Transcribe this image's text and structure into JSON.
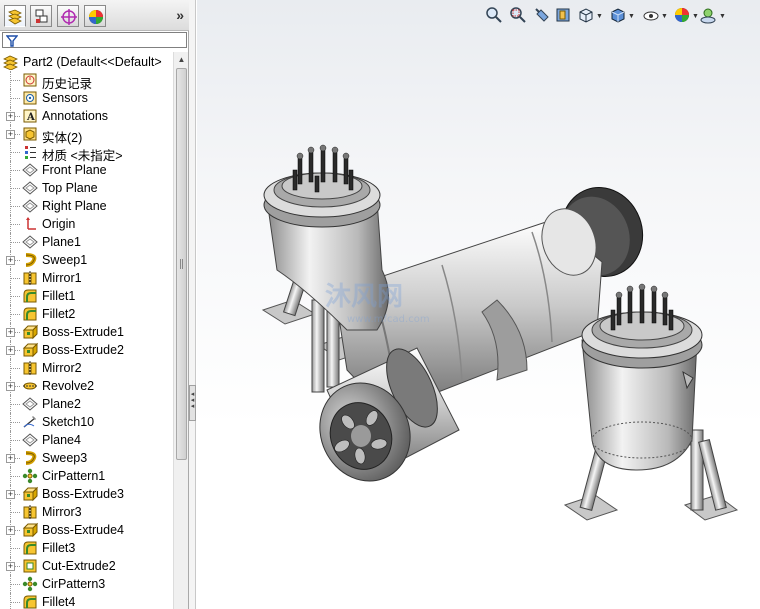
{
  "panel": {
    "tabs": [
      {
        "name": "featuremanager-tab",
        "icon": "featuremanager-icon"
      },
      {
        "name": "propertymanager-tab",
        "icon": "propertymanager-icon"
      },
      {
        "name": "configurationmanager-tab",
        "icon": "configurationmanager-icon"
      },
      {
        "name": "displaymanager-tab",
        "icon": "displaymanager-icon"
      }
    ],
    "expand_label": "»",
    "root_label": "Part2  (Default<<Default>"
  },
  "tree": {
    "items": [
      {
        "label": "历史记录",
        "icon": "history-icon",
        "expandable": false
      },
      {
        "label": "Sensors",
        "icon": "sensor-icon",
        "expandable": false
      },
      {
        "label": "Annotations",
        "icon": "annotation-icon",
        "expandable": true
      },
      {
        "label": "实体(2)",
        "icon": "solid-bodies-icon",
        "expandable": true
      },
      {
        "label": "材质 <未指定>",
        "icon": "material-icon",
        "expandable": false
      },
      {
        "label": "Front Plane",
        "icon": "plane-icon",
        "expandable": false
      },
      {
        "label": "Top Plane",
        "icon": "plane-icon",
        "expandable": false
      },
      {
        "label": "Right Plane",
        "icon": "plane-icon",
        "expandable": false
      },
      {
        "label": "Origin",
        "icon": "origin-icon",
        "expandable": false
      },
      {
        "label": "Plane1",
        "icon": "plane-icon",
        "expandable": false
      },
      {
        "label": "Sweep1",
        "icon": "sweep-icon",
        "expandable": true
      },
      {
        "label": "Mirror1",
        "icon": "mirror-icon",
        "expandable": false
      },
      {
        "label": "Fillet1",
        "icon": "fillet-icon",
        "expandable": false
      },
      {
        "label": "Fillet2",
        "icon": "fillet-icon",
        "expandable": false
      },
      {
        "label": "Boss-Extrude1",
        "icon": "extrude-icon",
        "expandable": true
      },
      {
        "label": "Boss-Extrude2",
        "icon": "extrude-icon",
        "expandable": true
      },
      {
        "label": "Mirror2",
        "icon": "mirror-icon",
        "expandable": false
      },
      {
        "label": "Revolve2",
        "icon": "revolve-icon",
        "expandable": true
      },
      {
        "label": "Plane2",
        "icon": "plane-icon",
        "expandable": false
      },
      {
        "label": "Sketch10",
        "icon": "sketch-icon",
        "expandable": false
      },
      {
        "label": "Plane4",
        "icon": "plane-icon",
        "expandable": false
      },
      {
        "label": "Sweep3",
        "icon": "sweep-icon",
        "expandable": true
      },
      {
        "label": "CirPattern1",
        "icon": "circular-pattern-icon",
        "expandable": false
      },
      {
        "label": "Boss-Extrude3",
        "icon": "extrude-icon",
        "expandable": true
      },
      {
        "label": "Mirror3",
        "icon": "mirror-icon",
        "expandable": false
      },
      {
        "label": "Boss-Extrude4",
        "icon": "extrude-icon",
        "expandable": true
      },
      {
        "label": "Fillet3",
        "icon": "fillet-icon",
        "expandable": false
      },
      {
        "label": "Cut-Extrude2",
        "icon": "cut-extrude-icon",
        "expandable": true
      },
      {
        "label": "CirPattern3",
        "icon": "circular-pattern-icon",
        "expandable": false
      },
      {
        "label": "Fillet4",
        "icon": "fillet-icon",
        "expandable": false
      }
    ]
  },
  "viewport": {
    "toolbar": [
      {
        "name": "zoom-to-fit-icon"
      },
      {
        "name": "zoom-to-area-icon"
      },
      {
        "name": "previous-view-icon"
      },
      {
        "name": "section-view-icon"
      },
      {
        "name": "view-orientation-icon"
      },
      {
        "name": "display-style-icon"
      },
      {
        "name": "hide-show-items-icon"
      },
      {
        "name": "edit-appearance-icon"
      },
      {
        "name": "apply-scene-icon"
      }
    ],
    "watermark": "沐风网",
    "watermark_sub": "www.mfcad.com"
  }
}
